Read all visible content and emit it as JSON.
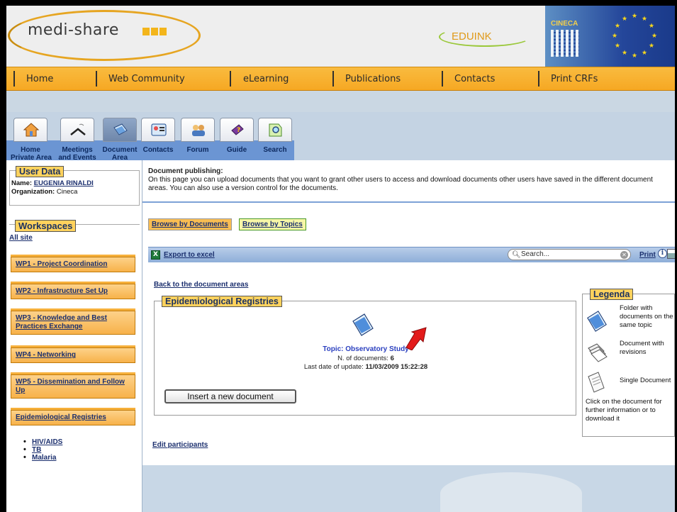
{
  "brand": {
    "logo_text": "medi-share",
    "edulink_text": "EDUINK",
    "cineca_text": "CINECA"
  },
  "nav": {
    "items": [
      "Home",
      "Web Community",
      "eLearning",
      "Publications",
      "Contacts",
      "Print CRFs"
    ]
  },
  "tabs": [
    {
      "label": "Home\nPrivate Area",
      "icon": "home-icon"
    },
    {
      "label": "Meetings\nand Events",
      "icon": "meetings-icon"
    },
    {
      "label": "Document\nArea",
      "icon": "document-area-icon"
    },
    {
      "label": "Contacts",
      "icon": "contacts-icon"
    },
    {
      "label": "Forum",
      "icon": "forum-icon"
    },
    {
      "label": "Guide",
      "icon": "guide-icon"
    },
    {
      "label": "Search",
      "icon": "search-icon"
    }
  ],
  "user_data": {
    "title": "User Data",
    "name_label": "Name:",
    "name_value": "EUGENIA RINALDI",
    "org_label": "Organization:",
    "org_value": "Cineca"
  },
  "workspaces": {
    "title": "Workspaces",
    "all_site": "All site",
    "items": [
      "WP1 - Project Coordination",
      "WP2 - Infrastructure Set Up",
      "WP3 - Knowledge and Best Practices Exchange",
      "WP4 - Networking",
      "WP5 - Dissemination and Follow Up",
      "Epidemiological Registries"
    ],
    "sub_items": [
      "HIV/AIDS",
      "TB",
      "Malaria"
    ]
  },
  "main": {
    "intro_title": "Document publishing:",
    "intro_text": "On this page you can upload documents that you want to grant other users to access and download documents other users have saved in the different document areas. You can also use a version control for the documents.",
    "browse_docs": "Browse by Documents",
    "browse_topics": "Browse by Topics",
    "export_label": "Export to excel",
    "search_placeholder": "Search...",
    "print_label": "Print",
    "back_link": "Back to the document areas",
    "section_title": "Epidemiological Registries",
    "topic": "Topic: Observatory Study",
    "ndocs_label": "N. of documents:",
    "ndocs_value": "6",
    "last_update_label": "Last date of update:",
    "last_update_value": "11/03/2009 15:22:28",
    "insert_button": "Insert a new document",
    "edit_participants": "Edit participants"
  },
  "legenda": {
    "title": "Legenda",
    "folder_text": "Folder with documents on the same topic",
    "revisions_text": "Document with revisions",
    "single_text": "Single Document",
    "footer_text": "Click on the document for further information or to download it"
  },
  "colors": {
    "nav_orange": "#f6a823",
    "legend_yellow": "#ffd25d",
    "link_blue": "#1b2f6e",
    "arrow_red": "#e31b1b"
  }
}
